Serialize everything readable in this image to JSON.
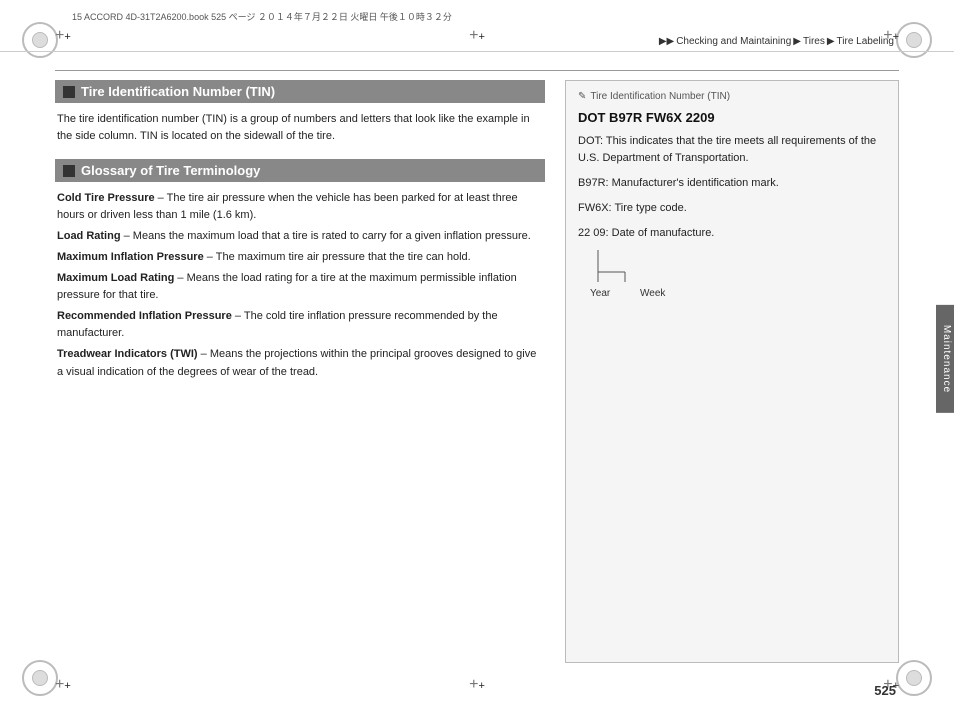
{
  "page": {
    "number": "525",
    "file_info": "15 ACCORD 4D-31T2A6200.book  525 ページ  ２０１４年７月２２日  火曜日  午後１０時３２分"
  },
  "breadcrumb": {
    "arrow1": "▶▶",
    "part1": "Checking and Maintaining",
    "arrow2": "▶",
    "part2": "Tires",
    "arrow3": "▶",
    "part3": "Tire Labeling"
  },
  "sidebar_tab": {
    "label": "Maintenance"
  },
  "tin_section": {
    "header": "Tire Identification Number (TIN)",
    "body": "The tire identification number (TIN) is a group of numbers and letters that look like the example in the side column. TIN is located on the sidewall of the tire."
  },
  "glossary_section": {
    "header": "Glossary of Tire Terminology",
    "items": [
      {
        "term": "Cold Tire Pressure",
        "definition": " – The tire air pressure when the vehicle has been parked for at least three hours or driven less than 1 mile (1.6 km)."
      },
      {
        "term": "Load Rating",
        "definition": " – Means the maximum load that a tire is rated to carry for a given inflation pressure."
      },
      {
        "term": "Maximum Inflation Pressure",
        "definition": " – The maximum tire air pressure that the tire can hold."
      },
      {
        "term": "Maximum Load Rating",
        "definition": " – Means the load rating for a tire at the maximum permissible inflation pressure for that tire."
      },
      {
        "term": "Recommended Inflation Pressure",
        "definition": " – The cold tire inflation pressure recommended by the manufacturer."
      },
      {
        "term": "Treadwear Indicators (TWI)",
        "definition": " – Means the projections within the principal grooves designed to give a visual indication of the degrees of wear of the tread."
      }
    ]
  },
  "right_column": {
    "title_prefix": "✎",
    "title": "Tire Identification Number (TIN)",
    "tin_number": "DOT B97R FW6X 2209",
    "descriptions": [
      "DOT: This indicates that the tire meets all requirements of the U.S. Department of Transportation.",
      "B97R: Manufacturer's identification mark.",
      "FW6X: Tire type code.",
      "22 09: Date of manufacture."
    ],
    "year_label": "Year",
    "week_label": "Week"
  }
}
